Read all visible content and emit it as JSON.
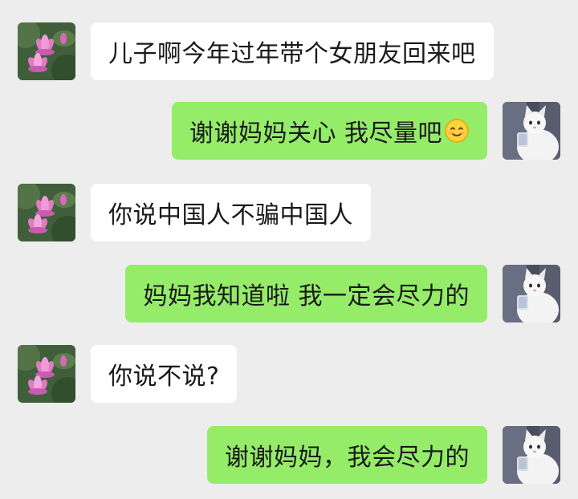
{
  "chat": {
    "colors": {
      "background": "#ededed",
      "incoming_bubble": "#ffffff",
      "outgoing_bubble": "#95ec69",
      "text": "#1a1a1a"
    },
    "messages": [
      {
        "sender": "mom",
        "text": "儿子啊今年过年带个女朋友回来吧",
        "avatar_icon": "lotus-avatar-icon"
      },
      {
        "sender": "son",
        "text": "谢谢妈妈关心 我尽量吧",
        "emoji": "smiling-face-emoji-icon",
        "avatar_icon": "cat-avatar-icon"
      },
      {
        "sender": "mom",
        "text": "你说中国人不骗中国人",
        "avatar_icon": "lotus-avatar-icon"
      },
      {
        "sender": "son",
        "text": "妈妈我知道啦 我一定会尽力的",
        "avatar_icon": "cat-avatar-icon"
      },
      {
        "sender": "mom",
        "text": "你说不说?",
        "avatar_icon": "lotus-avatar-icon"
      },
      {
        "sender": "son",
        "text": "谢谢妈妈，我会尽力的",
        "avatar_icon": "cat-avatar-icon"
      }
    ]
  }
}
